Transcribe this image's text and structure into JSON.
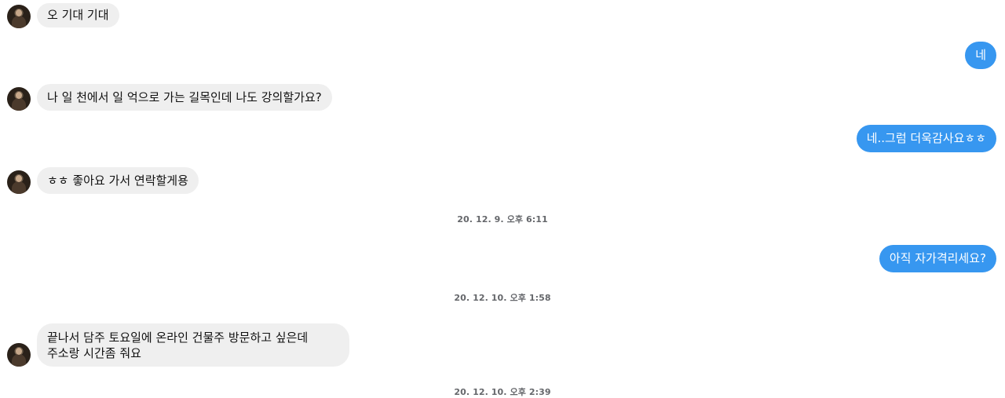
{
  "messages": [
    {
      "side": "in",
      "text": "오 기대 기대"
    },
    {
      "side": "out",
      "text": "네"
    },
    {
      "side": "in",
      "text": "나 일 천에서  일 억으로 가는 길목인데 나도 강의할가요?"
    },
    {
      "side": "out",
      "text": "네..그럼 더욱감사요ㅎㅎ"
    },
    {
      "side": "in",
      "text": "ㅎㅎ 좋아요 가서 연락할게용"
    },
    {
      "side": "out",
      "text": "아직 자가격리세요?"
    },
    {
      "side": "in",
      "lines": [
        "끝나서 담주 토요일에  온라인 건물주 방문하고 싶은데",
        "주소랑 시간좀 줘요"
      ]
    }
  ],
  "timestamps": [
    "20. 12. 9. 오후 6:11",
    "20. 12. 10. 오후 1:58",
    "20. 12. 10. 오후 2:39"
  ],
  "colors": {
    "incoming_bubble": "#efefef",
    "outgoing_bubble": "#3797f0",
    "timestamp_text": "#65676b"
  },
  "icons": {
    "avatar": "contact-avatar"
  }
}
